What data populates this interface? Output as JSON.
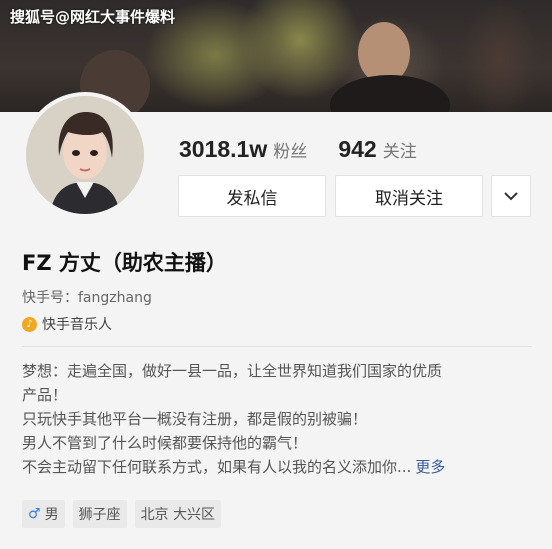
{
  "watermark": "搜狐号@网红大事件爆料",
  "profile": {
    "followers_count": "3018.1w",
    "followers_label": "粉丝",
    "following_count": "942",
    "following_label": "关注",
    "message_button": "发私信",
    "unfollow_button": "取消关注",
    "name": "FZ 方丈（助农主播）",
    "user_id": "快手号：fangzhang",
    "badge": "快手音乐人",
    "bio": [
      "梦想：走遍全国，做好一县一品，让全世界知道我们国家的优质",
      "产品！",
      "只玩快手其他平台一概没有注册，都是假的别被骗！",
      "男人不管到了什么时候都要保持他的霸气！",
      "不会主动留下任何联系方式，如果有人以我的名义添加你..."
    ],
    "more_link": "更多",
    "tags": {
      "gender": "男",
      "zodiac": "狮子座",
      "location": "北京 大兴区"
    }
  },
  "colors": {
    "link": "#3a5a98",
    "badge": "#f0a722",
    "male": "#3a7bd5"
  }
}
